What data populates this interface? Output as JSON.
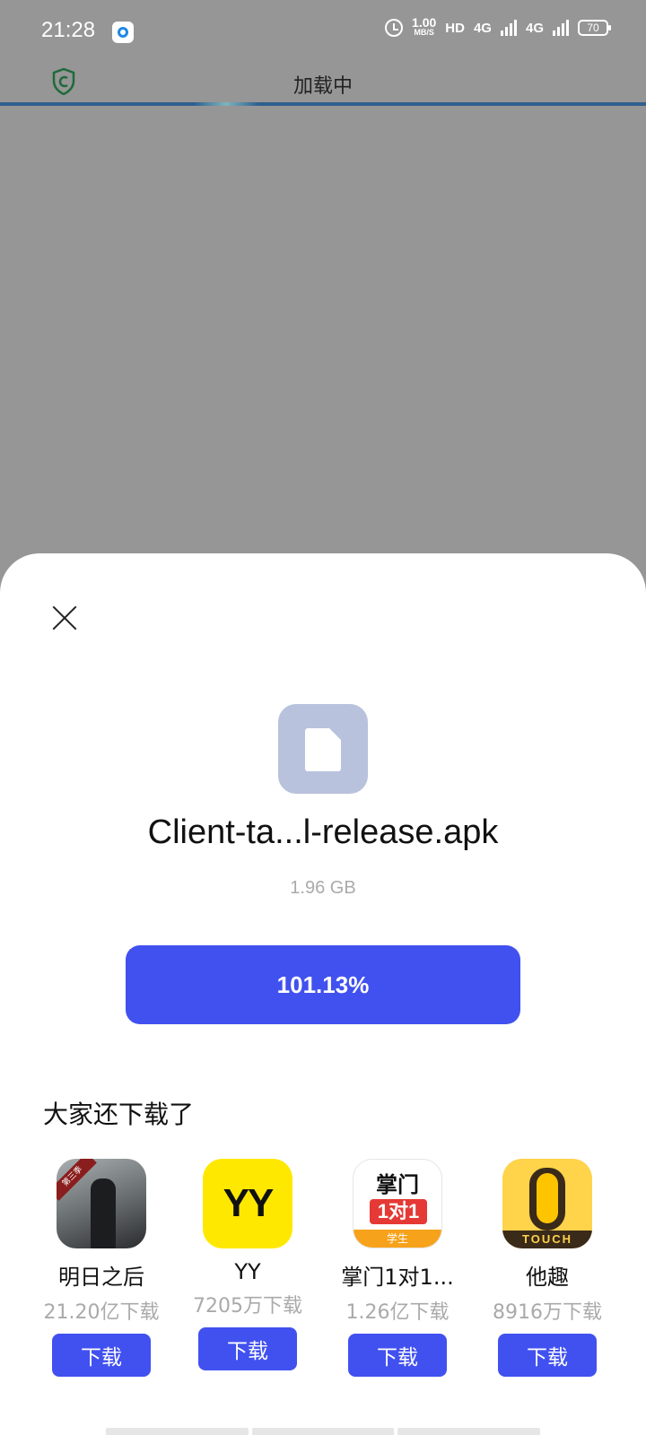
{
  "status_bar": {
    "time": "21:28",
    "net_speed": "1.00",
    "net_speed_unit": "MB/S",
    "hd": "HD",
    "network_1": "4G",
    "network_2": "4G",
    "battery": "70"
  },
  "toolbar": {
    "title": "加载中"
  },
  "page_load_progress": 0.35,
  "download_sheet": {
    "file_name": "Client-ta...l-release.apk",
    "file_size": "1.96 GB",
    "progress_label": "101.13%"
  },
  "recommendations": {
    "title": "大家还下载了",
    "apps": [
      {
        "name": "明日之后",
        "downloads": "21.20亿下载",
        "button": "下载",
        "icon": "mingri-app-icon"
      },
      {
        "name": "YY",
        "downloads": "7205万下载",
        "button": "下载",
        "icon": "yy-app-icon"
      },
      {
        "name": "掌门1对1...",
        "downloads": "1.26亿下载",
        "button": "下载",
        "icon": "zhangmen-app-icon"
      },
      {
        "name": "他趣",
        "downloads": "8916万下载",
        "button": "下载",
        "icon": "tacu-app-icon"
      }
    ]
  }
}
